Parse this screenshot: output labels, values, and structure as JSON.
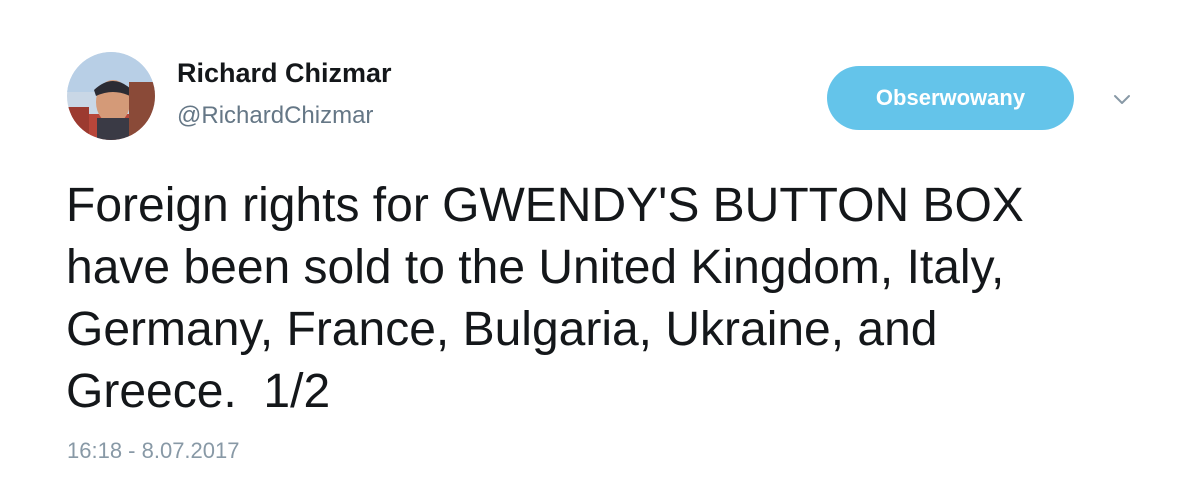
{
  "author": {
    "display_name": "Richard Chizmar",
    "handle": "@RichardChizmar"
  },
  "follow_button": {
    "label": "Obserwowany",
    "color": "#64c4ea"
  },
  "menu": {
    "icon": "chevron-down-icon"
  },
  "tweet": {
    "lines": [
      "Foreign rights for GWENDY'S BUTTON BOX",
      "have been sold to the United Kingdom, Italy,",
      "Germany, France, Bulgaria, Ukraine, and",
      "Greece.  1/2"
    ],
    "timestamp": "16:18 - 8.07.2017"
  },
  "colors": {
    "text": "#14171a",
    "secondary": "#657786",
    "timestamp": "#8899a6"
  }
}
